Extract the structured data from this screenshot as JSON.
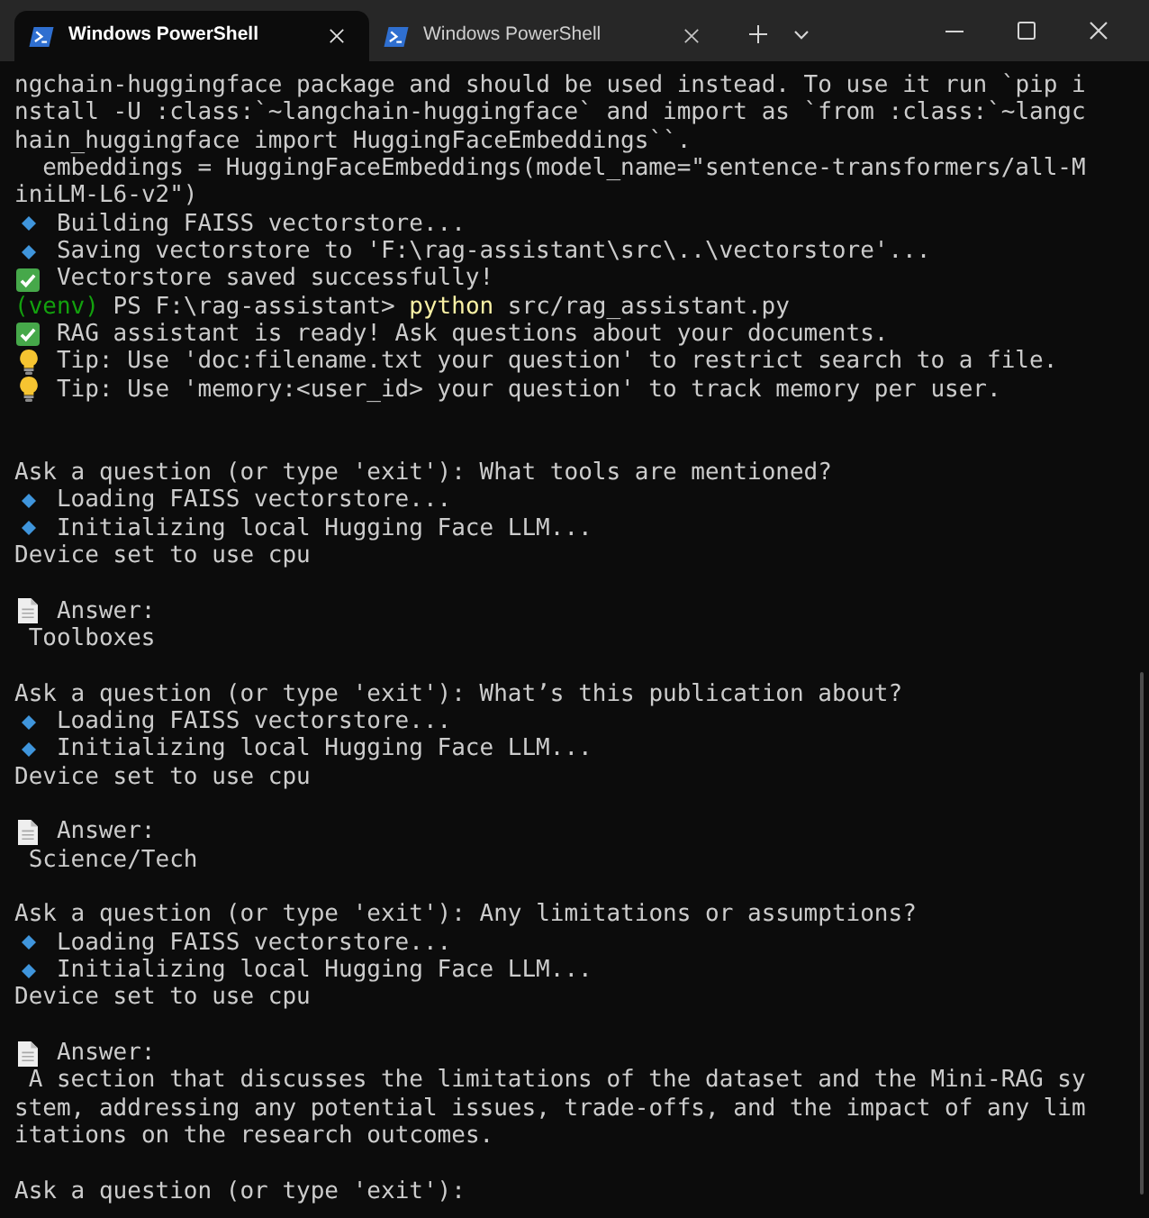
{
  "window": {
    "tabs": [
      {
        "title": "Windows PowerShell",
        "selected": true
      },
      {
        "title": "Windows PowerShell",
        "selected": false
      }
    ]
  },
  "terminal": {
    "lines": [
      {
        "kind": "text",
        "text": "ngchain-huggingface package and should be used instead. To use it run `pip install -U :class:`~langchain-huggingface` and import as `from :class:`~langchain_huggingface import HuggingFaceEmbeddings``."
      },
      {
        "kind": "indented",
        "text": "embeddings = HuggingFaceEmbeddings(model_name=\"sentence-transformers/all-MiniLM-L6-v2\")"
      },
      {
        "kind": "info",
        "text": "Building FAISS vectorstore..."
      },
      {
        "kind": "info",
        "text": "Saving vectorstore to 'F:\\rag-assistant\\src\\..\\vectorstore'..."
      },
      {
        "kind": "success",
        "text": "Vectorstore saved successfully!"
      },
      {
        "kind": "command",
        "env": "(venv)",
        "prompt": "PS F:\\rag-assistant>",
        "program": "python",
        "args": "src/rag_assistant.py"
      },
      {
        "kind": "success",
        "text": "RAG assistant is ready! Ask questions about your documents."
      },
      {
        "kind": "tip",
        "text": "Tip: Use 'doc:filename.txt your question' to restrict search to a file."
      },
      {
        "kind": "tip",
        "text": "Tip: Use 'memory:<user_id> your question' to track memory per user."
      },
      {
        "kind": "blank"
      },
      {
        "kind": "blank"
      },
      {
        "kind": "text",
        "text": "Ask a question (or type 'exit'): What tools are mentioned?"
      },
      {
        "kind": "info",
        "text": "Loading FAISS vectorstore..."
      },
      {
        "kind": "info",
        "text": "Initializing local Hugging Face LLM..."
      },
      {
        "kind": "text",
        "text": "Device set to use cpu"
      },
      {
        "kind": "blank"
      },
      {
        "kind": "answer_heading",
        "text": "Answer:"
      },
      {
        "kind": "answer",
        "text": "Toolboxes"
      },
      {
        "kind": "blank"
      },
      {
        "kind": "text",
        "text": "Ask a question (or type 'exit'): What’s this publication about?"
      },
      {
        "kind": "info",
        "text": "Loading FAISS vectorstore..."
      },
      {
        "kind": "info",
        "text": "Initializing local Hugging Face LLM..."
      },
      {
        "kind": "text",
        "text": "Device set to use cpu"
      },
      {
        "kind": "blank"
      },
      {
        "kind": "answer_heading",
        "text": "Answer:"
      },
      {
        "kind": "answer",
        "text": "Science/Tech"
      },
      {
        "kind": "blank"
      },
      {
        "kind": "text",
        "text": "Ask a question (or type 'exit'): Any limitations or assumptions?"
      },
      {
        "kind": "info",
        "text": "Loading FAISS vectorstore..."
      },
      {
        "kind": "info",
        "text": "Initializing local Hugging Face LLM..."
      },
      {
        "kind": "text",
        "text": "Device set to use cpu"
      },
      {
        "kind": "blank"
      },
      {
        "kind": "answer_heading",
        "text": "Answer:"
      },
      {
        "kind": "answer",
        "text": "A section that discusses the limitations of the dataset and the Mini-RAG system, addressing any potential issues, trade-offs, and the impact of any limitations on the research outcomes."
      },
      {
        "kind": "blank"
      },
      {
        "kind": "text",
        "text": "Ask a question (or type 'exit'):"
      }
    ]
  }
}
